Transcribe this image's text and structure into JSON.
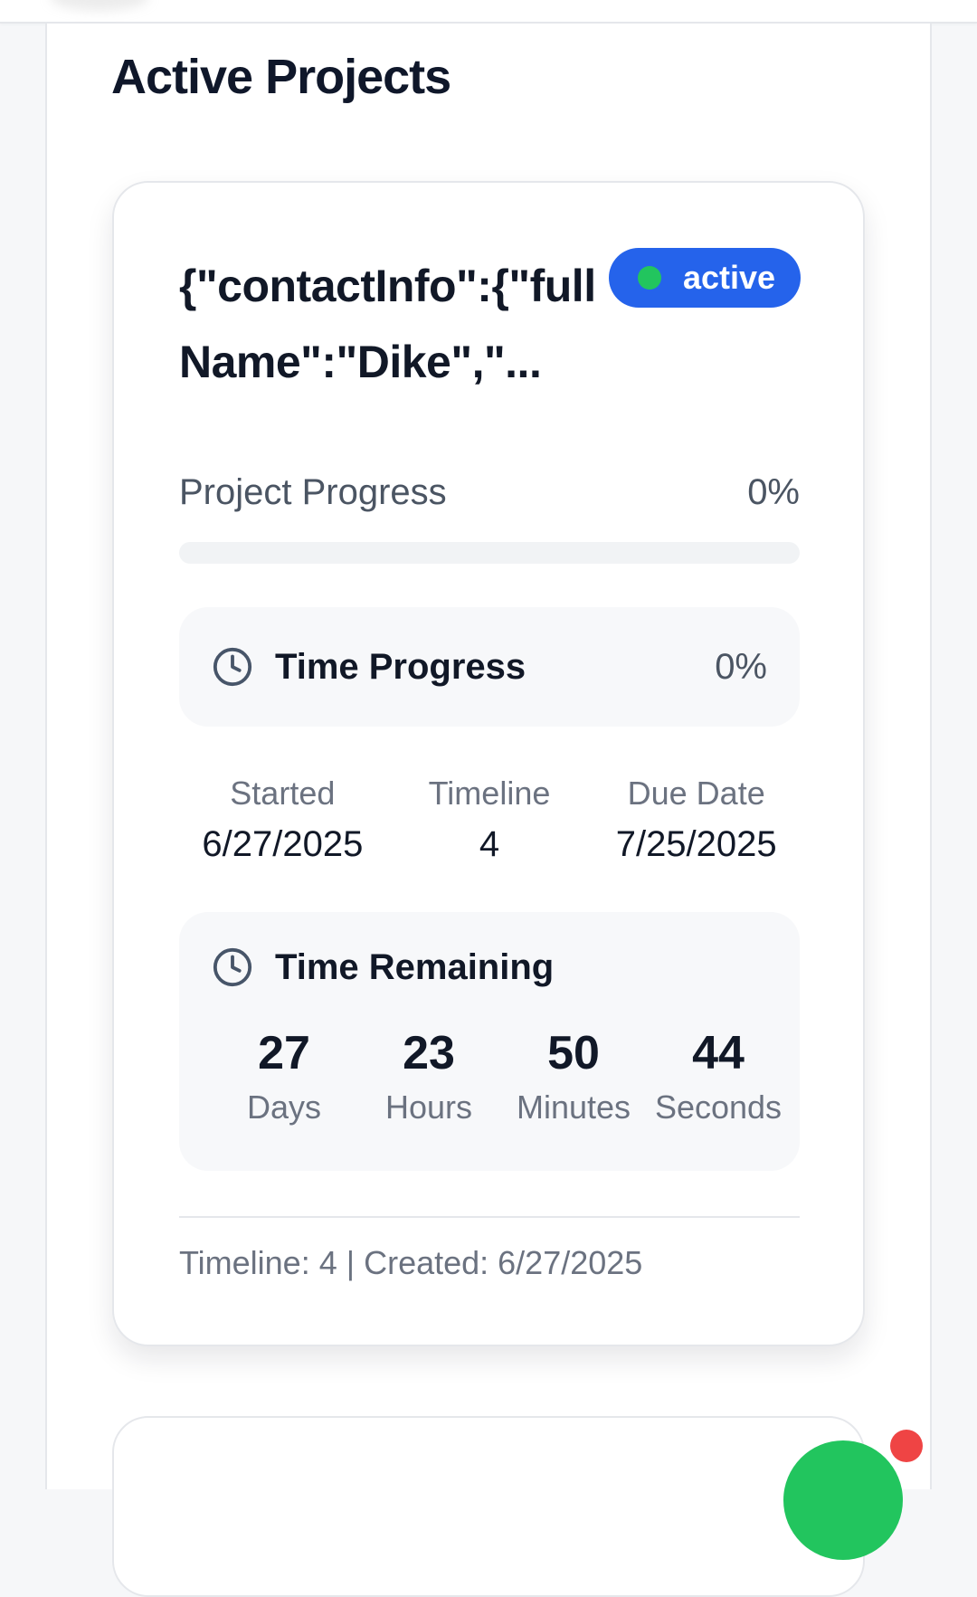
{
  "section": {
    "title": "Active Projects"
  },
  "project": {
    "title": "{\"contactInfo\":{\"fullName\":\"Dike\",\"...",
    "status": "active",
    "progress": {
      "label": "Project Progress",
      "value_text": "0%",
      "percent": 0
    },
    "time_progress": {
      "label": "Time Progress",
      "value_text": "0%"
    },
    "dates": {
      "started_label": "Started",
      "started_value": "6/27/2025",
      "timeline_label": "Timeline",
      "timeline_value": "4",
      "due_label": "Due Date",
      "due_value": "7/25/2025"
    },
    "remaining": {
      "label": "Time Remaining",
      "days": "27",
      "days_label": "Days",
      "hours": "23",
      "hours_label": "Hours",
      "minutes": "50",
      "minutes_label": "Minutes",
      "seconds": "44",
      "seconds_label": "Seconds"
    },
    "footer": "Timeline: 4 | Created: 6/27/2025"
  },
  "colors": {
    "accent": "#2563eb",
    "status_dot": "#22c55e",
    "fab": "#22c55e",
    "notification": "#ef4444"
  },
  "icons": {
    "time_progress": "clock-icon",
    "time_remaining": "clock-icon"
  }
}
